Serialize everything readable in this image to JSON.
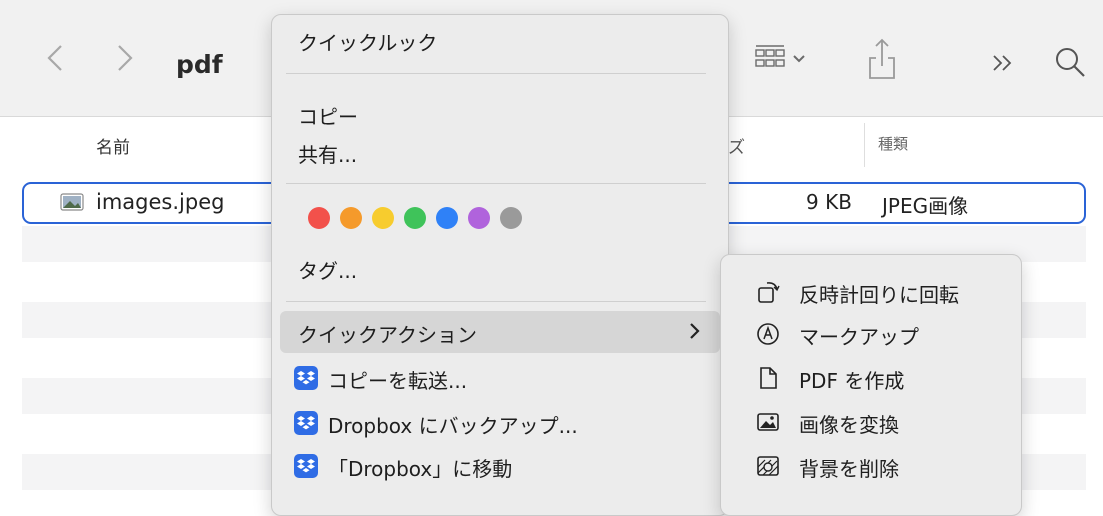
{
  "toolbar": {
    "folder_title": "pdf",
    "back_icon": "chevron-left-icon",
    "forward_icon": "chevron-right-icon",
    "view_icon": "grid-view-icon",
    "share_icon": "share-icon",
    "more_icon": "double-chevron-icon",
    "search_icon": "search-icon"
  },
  "columns": {
    "name": "名前",
    "size": "ズ",
    "kind": "種類"
  },
  "file": {
    "name": "images.jpeg",
    "size": "9 KB",
    "kind": "JPEG画像",
    "icon": "jpeg-file-icon"
  },
  "menu": {
    "quick_look": "クイックルック",
    "copy": "コピー",
    "share": "共有...",
    "tags_label": "タグ...",
    "tag_colors": [
      "#f2514b",
      "#f59a2b",
      "#f7cc2e",
      "#3fc35a",
      "#2f81f7",
      "#b063dc",
      "#9a9a9a"
    ],
    "quick_actions": "クイックアクション",
    "dropbox_items": [
      "コピーを転送...",
      "Dropbox にバックアップ...",
      "「Dropbox」に移動"
    ]
  },
  "submenu": {
    "items": [
      {
        "label": "反時計回りに回転",
        "icon": "rotate-left-icon"
      },
      {
        "label": "マークアップ",
        "icon": "markup-icon"
      },
      {
        "label": "PDF を作成",
        "icon": "document-icon"
      },
      {
        "label": "画像を変換",
        "icon": "image-convert-icon"
      },
      {
        "label": "背景を削除",
        "icon": "remove-background-icon"
      }
    ]
  },
  "colors": {
    "selection_border": "#2a63d6",
    "menu_bg": "#ececec",
    "highlight": "#d6d6d6",
    "dropbox_blue": "#2f6ce5"
  }
}
